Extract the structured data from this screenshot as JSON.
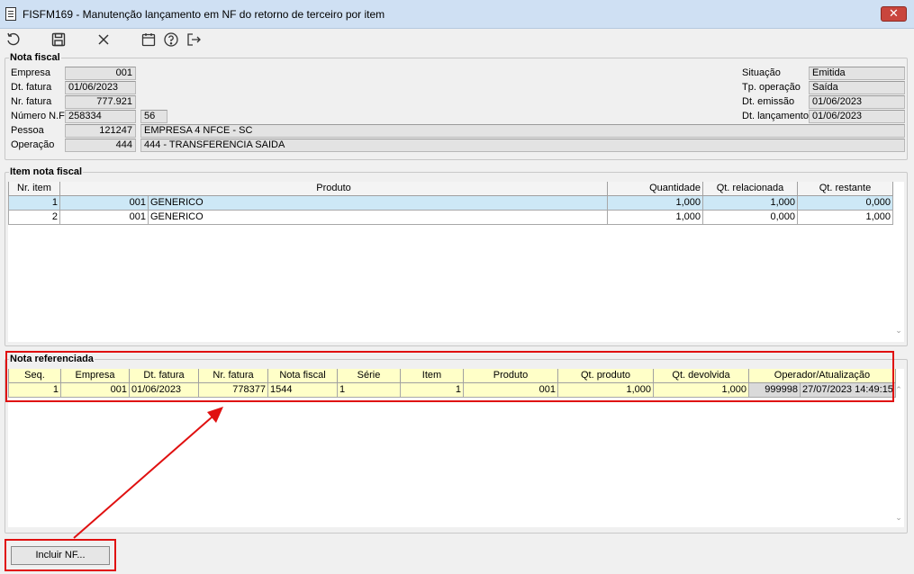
{
  "window": {
    "title": "FISFM169 - Manutenção lançamento em NF do retorno de terceiro por item",
    "close_glyph": "✕"
  },
  "toolbar": [
    "refresh-icon",
    "save-icon",
    "cancel-icon",
    "calendar-icon",
    "help-icon",
    "exit-icon"
  ],
  "nota_fiscal": {
    "legend": "Nota fiscal",
    "empresa": {
      "label": "Empresa",
      "value": "001"
    },
    "dt_fatura": {
      "label": "Dt. fatura",
      "value": "01/06/2023"
    },
    "nr_fatura": {
      "label": "Nr. fatura",
      "value": "777.921"
    },
    "numero_nf": {
      "label": "Número N.F",
      "value": "258334",
      "serie": "56"
    },
    "pessoa": {
      "label": "Pessoa",
      "code": "121247",
      "name": "EMPRESA 4 NFCE - SC"
    },
    "operacao": {
      "label": "Operação",
      "code": "444",
      "name": "444 - TRANSFERENCIA SAIDA"
    },
    "situacao": {
      "label": "Situação",
      "value": "Emitida"
    },
    "tp_operacao": {
      "label": "Tp. operação",
      "value": "Saída"
    },
    "dt_emissao": {
      "label": "Dt. emissão",
      "value": "01/06/2023"
    },
    "dt_lancamento": {
      "label": "Dt. lançamento",
      "value": "01/06/2023"
    }
  },
  "item_nota": {
    "legend": "Item nota fiscal",
    "columns": [
      "Nr. item",
      "Produto",
      "Quantidade",
      "Qt. relacionada",
      "Qt. restante"
    ],
    "rows": [
      {
        "nr": "1",
        "cod": "001",
        "produto": "GENERICO",
        "qtd": "1,000",
        "rel": "1,000",
        "rest": "0,000"
      },
      {
        "nr": "2",
        "cod": "001",
        "produto": "GENERICO",
        "qtd": "1,000",
        "rel": "0,000",
        "rest": "1,000"
      }
    ]
  },
  "nota_ref": {
    "legend": "Nota referenciada",
    "columns": [
      "Seq.",
      "Empresa",
      "Dt. fatura",
      "Nr. fatura",
      "Nota fiscal",
      "Série",
      "Item",
      "Produto",
      "Qt. produto",
      "Qt. devolvida",
      "Operador/Atualização"
    ],
    "rows": [
      {
        "seq": "1",
        "empresa": "001",
        "dt_fatura": "01/06/2023",
        "nr_fatura": "778377",
        "nota": "1544",
        "serie": "1",
        "item": "1",
        "produto": "001",
        "qt_prod": "1,000",
        "qt_dev": "1,000",
        "operador": "999998",
        "atualizacao": "27/07/2023 14:49:15"
      }
    ]
  },
  "buttons": {
    "incluir": "Incluir NF..."
  },
  "colors": {
    "highlight": "#e01010",
    "selected_row": "#cde8f6",
    "yellow_grid": "#ffffc8"
  }
}
